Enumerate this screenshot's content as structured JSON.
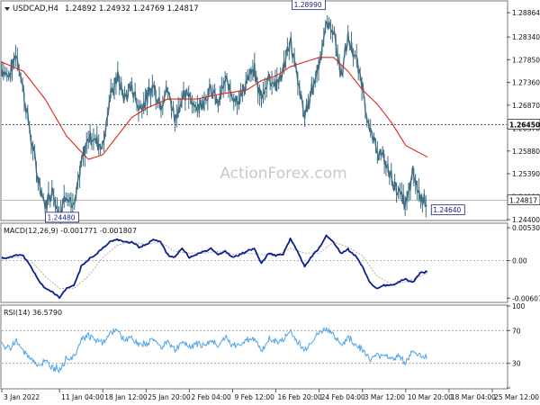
{
  "header": {
    "symbol": "USDCAD,H4",
    "ohlc": "1.24892 1.24932 1.24769 1.24817"
  },
  "watermark": "ActionForex.com",
  "colors": {
    "price": "#3d6e83",
    "ma": "#e0251b",
    "macd_main": "#0c1f8f",
    "macd_signal": "#b9a9a9",
    "rsi": "#4fa6e8",
    "grid": "#9a9a9a",
    "text": "#111111",
    "label_box": "#1a237e"
  },
  "chart_data": [
    {
      "type": "line",
      "name": "price",
      "y_ticks": [
        "1.28864",
        "1.28340",
        "1.27850",
        "1.27360",
        "1.26870",
        "1.26370",
        "1.25880",
        "1.25390",
        "1.24900",
        "1.24400"
      ],
      "ylim": [
        1.244,
        1.291
      ],
      "current": "1.24817",
      "levels": [
        {
          "label": "1.26450",
          "value": 1.2645
        }
      ],
      "annotations": [
        {
          "label": "1.28990",
          "x": 42.5,
          "value": 1.2899
        },
        {
          "label": "1.24480",
          "x": 8.3,
          "value": 1.2448
        },
        {
          "label": "1.24640",
          "x": 61.8,
          "value": 1.2464
        }
      ],
      "x_labels": [
        {
          "label": "3 Jan 2022",
          "x": 0
        },
        {
          "label": "11 Jan 04:00",
          "x": 8
        },
        {
          "label": "18 Jan 12:00",
          "x": 14
        },
        {
          "label": "25 Jan 20:00",
          "x": 20
        },
        {
          "label": "2 Feb 04:00",
          "x": 26
        },
        {
          "label": "9 Feb 12:00",
          "x": 32
        },
        {
          "label": "16 Feb 20:00",
          "x": 38
        },
        {
          "label": "24 Feb 04:00",
          "x": 44
        },
        {
          "label": "3 Mar 12:00",
          "x": 50
        },
        {
          "label": "10 Mar 20:00",
          "x": 56
        },
        {
          "label": "18 Mar 04:00",
          "x": 62
        },
        {
          "label": "25 Mar 12:00",
          "x": 68
        }
      ],
      "price_knots": [
        [
          0,
          1.2765
        ],
        [
          1,
          1.275
        ],
        [
          2,
          1.28
        ],
        [
          3,
          1.272
        ],
        [
          4,
          1.262
        ],
        [
          5,
          1.253
        ],
        [
          6,
          1.247
        ],
        [
          7,
          1.2505
        ],
        [
          8,
          1.245
        ],
        [
          9,
          1.25
        ],
        [
          10,
          1.246
        ],
        [
          11,
          1.256
        ],
        [
          12,
          1.262
        ],
        [
          13,
          1.261
        ],
        [
          14,
          1.26
        ],
        [
          15,
          1.27
        ],
        [
          16,
          1.275
        ],
        [
          17,
          1.27
        ],
        [
          18,
          1.273
        ],
        [
          19,
          1.268
        ],
        [
          20,
          1.27
        ],
        [
          21,
          1.273
        ],
        [
          22,
          1.269
        ],
        [
          23,
          1.272
        ],
        [
          24,
          1.266
        ],
        [
          25,
          1.27
        ],
        [
          26,
          1.271
        ],
        [
          27,
          1.268
        ],
        [
          28,
          1.27
        ],
        [
          29,
          1.272
        ],
        [
          30,
          1.269
        ],
        [
          31,
          1.274
        ],
        [
          32,
          1.271
        ],
        [
          33,
          1.27
        ],
        [
          34,
          1.274
        ],
        [
          35,
          1.276
        ],
        [
          36,
          1.27
        ],
        [
          37,
          1.275
        ],
        [
          38,
          1.273
        ],
        [
          39,
          1.276
        ],
        [
          40,
          1.283
        ],
        [
          41,
          1.274
        ],
        [
          42,
          1.266
        ],
        [
          43,
          1.272
        ],
        [
          44,
          1.278
        ],
        [
          45,
          1.286
        ],
        [
          46,
          1.285
        ],
        [
          47,
          1.275
        ],
        [
          48,
          1.283
        ],
        [
          49,
          1.279
        ],
        [
          50,
          1.273
        ],
        [
          51,
          1.263
        ],
        [
          52,
          1.259
        ],
        [
          53,
          1.257
        ],
        [
          54,
          1.253
        ],
        [
          55,
          1.25
        ],
        [
          56,
          1.247
        ],
        [
          57,
          1.254
        ],
        [
          58,
          1.249
        ],
        [
          59,
          1.2482
        ]
      ],
      "ma_knots": [
        [
          0,
          1.278
        ],
        [
          3,
          1.276
        ],
        [
          6,
          1.27
        ],
        [
          9,
          1.262
        ],
        [
          12,
          1.257
        ],
        [
          14,
          1.258
        ],
        [
          16,
          1.262
        ],
        [
          18,
          1.266
        ],
        [
          20,
          1.268
        ],
        [
          23,
          1.27
        ],
        [
          27,
          1.27
        ],
        [
          30,
          1.271
        ],
        [
          34,
          1.272
        ],
        [
          36,
          1.274
        ],
        [
          38,
          1.275
        ],
        [
          40,
          1.277
        ],
        [
          42,
          1.278
        ],
        [
          44,
          1.279
        ],
        [
          46,
          1.279
        ],
        [
          48,
          1.276
        ],
        [
          50,
          1.272
        ],
        [
          52,
          1.269
        ],
        [
          54,
          1.265
        ],
        [
          56,
          1.26
        ],
        [
          59,
          1.2575
        ]
      ],
      "x_max": 70
    },
    {
      "type": "line",
      "name": "MACD(12,26,9) -0.001771 -0.001807",
      "label": "MACD(12,26,9) -0.001771 -0.001807",
      "y_ticks": [
        {
          "label": "0.005307",
          "value": 0.005307
        },
        {
          "label": "0.00",
          "value": 0.0
        },
        {
          "label": "-0.006074",
          "value": -0.006074
        }
      ],
      "ylim": [
        -0.0066,
        0.0059
      ],
      "main": [
        [
          0,
          0.0005
        ],
        [
          1,
          0.0004
        ],
        [
          2,
          0.001
        ],
        [
          3,
          0.0008
        ],
        [
          4,
          -0.001
        ],
        [
          5,
          -0.003
        ],
        [
          6,
          -0.0045
        ],
        [
          7,
          -0.005
        ],
        [
          8,
          -0.006
        ],
        [
          9,
          -0.0045
        ],
        [
          10,
          -0.004
        ],
        [
          11,
          -0.001
        ],
        [
          12,
          0.0002
        ],
        [
          13,
          0.001
        ],
        [
          14,
          0.002
        ],
        [
          15,
          0.003
        ],
        [
          16,
          0.0035
        ],
        [
          17,
          0.003
        ],
        [
          18,
          0.003
        ],
        [
          19,
          0.0022
        ],
        [
          20,
          0.0025
        ],
        [
          21,
          0.0035
        ],
        [
          22,
          0.003
        ],
        [
          23,
          0.001
        ],
        [
          24,
          0.0005
        ],
        [
          25,
          0.002
        ],
        [
          26,
          0.0005
        ],
        [
          27,
          0.001
        ],
        [
          28,
          0.0015
        ],
        [
          29,
          0.002
        ],
        [
          30,
          0.001
        ],
        [
          31,
          0.0015
        ],
        [
          32,
          0.0005
        ],
        [
          33,
          0.001
        ],
        [
          34,
          0.0015
        ],
        [
          35,
          0.002
        ],
        [
          36,
          -0.0005
        ],
        [
          37,
          0.0012
        ],
        [
          38,
          0.0008
        ],
        [
          39,
          0.001
        ],
        [
          40,
          0.0035
        ],
        [
          41,
          0.0015
        ],
        [
          42,
          -0.001
        ],
        [
          43,
          0.0008
        ],
        [
          44,
          0.002
        ],
        [
          45,
          0.004
        ],
        [
          46,
          0.003
        ],
        [
          47,
          0.0012
        ],
        [
          48,
          0.0018
        ],
        [
          49,
          0.0008
        ],
        [
          50,
          -0.001
        ],
        [
          51,
          -0.0035
        ],
        [
          52,
          -0.0045
        ],
        [
          53,
          -0.004
        ],
        [
          54,
          -0.004
        ],
        [
          55,
          -0.0035
        ],
        [
          56,
          -0.003
        ],
        [
          57,
          -0.0035
        ],
        [
          58,
          -0.002
        ],
        [
          59,
          -0.0018
        ]
      ],
      "signal": [
        [
          0,
          0.0003
        ],
        [
          2,
          0.0006
        ],
        [
          4,
          0.0
        ],
        [
          6,
          -0.0025
        ],
        [
          8,
          -0.0045
        ],
        [
          10,
          -0.0045
        ],
        [
          12,
          -0.0025
        ],
        [
          14,
          0.0005
        ],
        [
          16,
          0.0025
        ],
        [
          18,
          0.003
        ],
        [
          20,
          0.0026
        ],
        [
          22,
          0.003
        ],
        [
          24,
          0.0015
        ],
        [
          26,
          0.0012
        ],
        [
          28,
          0.0012
        ],
        [
          30,
          0.0015
        ],
        [
          32,
          0.001
        ],
        [
          34,
          0.0012
        ],
        [
          36,
          0.001
        ],
        [
          38,
          0.0008
        ],
        [
          40,
          0.002
        ],
        [
          42,
          0.0012
        ],
        [
          44,
          0.0012
        ],
        [
          46,
          0.003
        ],
        [
          48,
          0.0022
        ],
        [
          50,
          0.0008
        ],
        [
          52,
          -0.0025
        ],
        [
          54,
          -0.0038
        ],
        [
          56,
          -0.0034
        ],
        [
          58,
          -0.0026
        ],
        [
          59,
          -0.002
        ]
      ]
    },
    {
      "type": "line",
      "name": "RSI(14) 36.5790",
      "label": "RSI(14) 36.5790",
      "y_ticks": [
        {
          "label": "100",
          "value": 100
        },
        {
          "label": "70",
          "value": 70
        },
        {
          "label": "30",
          "value": 30
        },
        {
          "label": "0",
          "value": 0
        }
      ],
      "ylim": [
        0,
        100
      ],
      "levels": [
        70,
        30
      ],
      "values": [
        [
          0,
          52
        ],
        [
          1,
          48
        ],
        [
          2,
          58
        ],
        [
          3,
          44
        ],
        [
          4,
          36
        ],
        [
          5,
          28
        ],
        [
          6,
          32
        ],
        [
          7,
          26
        ],
        [
          8,
          22
        ],
        [
          9,
          36
        ],
        [
          10,
          38
        ],
        [
          11,
          60
        ],
        [
          12,
          64
        ],
        [
          13,
          58
        ],
        [
          14,
          56
        ],
        [
          15,
          66
        ],
        [
          16,
          70
        ],
        [
          17,
          58
        ],
        [
          18,
          62
        ],
        [
          19,
          52
        ],
        [
          20,
          54
        ],
        [
          21,
          60
        ],
        [
          22,
          50
        ],
        [
          23,
          58
        ],
        [
          24,
          46
        ],
        [
          25,
          56
        ],
        [
          26,
          50
        ],
        [
          27,
          54
        ],
        [
          28,
          52
        ],
        [
          29,
          58
        ],
        [
          30,
          52
        ],
        [
          31,
          62
        ],
        [
          32,
          50
        ],
        [
          33,
          54
        ],
        [
          34,
          58
        ],
        [
          35,
          62
        ],
        [
          36,
          44
        ],
        [
          37,
          60
        ],
        [
          38,
          56
        ],
        [
          39,
          58
        ],
        [
          40,
          70
        ],
        [
          41,
          56
        ],
        [
          42,
          46
        ],
        [
          43,
          58
        ],
        [
          44,
          66
        ],
        [
          45,
          72
        ],
        [
          46,
          66
        ],
        [
          47,
          52
        ],
        [
          48,
          62
        ],
        [
          49,
          54
        ],
        [
          50,
          46
        ],
        [
          51,
          36
        ],
        [
          52,
          38
        ],
        [
          53,
          42
        ],
        [
          54,
          36
        ],
        [
          55,
          38
        ],
        [
          56,
          32
        ],
        [
          57,
          44
        ],
        [
          58,
          40
        ],
        [
          59,
          37
        ]
      ]
    }
  ]
}
